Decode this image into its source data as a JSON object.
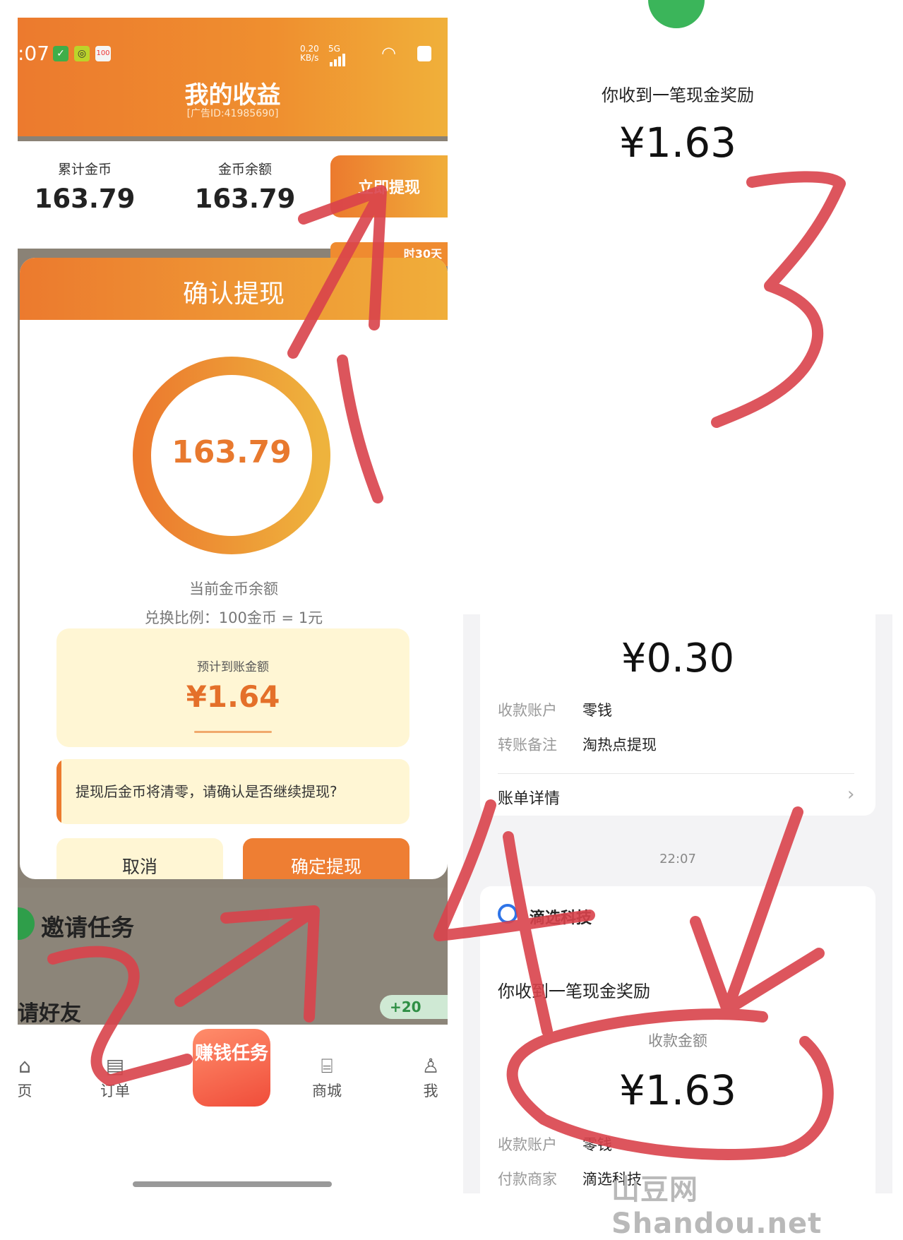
{
  "status_bar": {
    "time": ":07",
    "net_speed": "0.20",
    "net_unit": "KB/s",
    "net_type": "5G"
  },
  "header": {
    "title": "我的收益",
    "ad_id": "[广告ID:41985690]"
  },
  "stats": {
    "total_label": "累计金币",
    "total_value": "163.79",
    "balance_label": "金币余额",
    "balance_value": "163.79",
    "withdraw_now_label": "立即提现",
    "countdown_text": "时30天"
  },
  "dialog": {
    "title": "确认提现",
    "ring_value": "163.79",
    "ring_caption": "当前金币余额",
    "rate_text": "兑换比例：100金币 = 1元",
    "estimate_label": "预计到账金额",
    "estimate_amount": "¥1.64",
    "warning_text": "提现后金币将清零，请确认是否继续提现?",
    "cancel_label": "取消",
    "confirm_label": "确定提现"
  },
  "invite": {
    "title": "邀请任务",
    "row_text": "请好友",
    "coin_badge": "+20"
  },
  "bottom_nav": {
    "items": [
      {
        "label": "页",
        "icon": "home-icon"
      },
      {
        "label": "订单",
        "icon": "order-icon"
      },
      {
        "label": "商城",
        "icon": "shop-icon"
      },
      {
        "label": "我",
        "icon": "user-icon"
      }
    ],
    "earn_tile": "赚钱任务"
  },
  "right_top": {
    "title": "你收到一笔现金奖励",
    "amount": "¥1.63"
  },
  "right_bottom": {
    "amount1": "¥0.30",
    "account_label": "收款账户",
    "account_value": "零钱",
    "note_label": "转账备注",
    "note_value": "淘热点提现",
    "detail_label": "账单详情",
    "time": "22:07",
    "merchant_name": "滴选科技",
    "message": "你收到一笔现金奖励",
    "recv_label": "收款金额",
    "amount2": "¥1.63",
    "account_label2": "收款账户",
    "account_value2": "零钱",
    "payer_label": "付款商家",
    "payer_value": "滴选科技"
  },
  "annotations": {
    "num1": "1",
    "num2": "2",
    "num3": "3",
    "num4": "4",
    "color": "#d9434b"
  },
  "watermark": "山豆网 Shandou.net",
  "colors": {
    "orange": "#ec7a2e",
    "amber": "#f0ae3a",
    "cream": "#fff6d4",
    "wechat_green": "#3bb55a"
  }
}
